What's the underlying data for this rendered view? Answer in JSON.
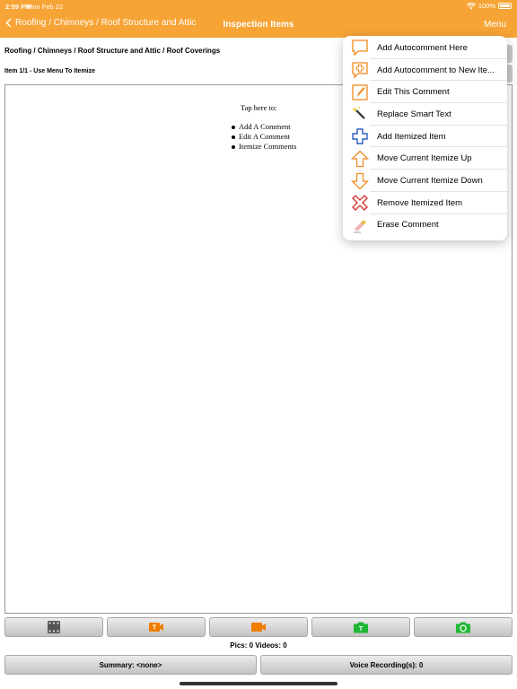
{
  "status": {
    "time": "2:59 PM",
    "date": "Mon Feb 22",
    "battery": "100%"
  },
  "nav": {
    "back_label": "Roofing / Chimneys / Roof Structure and Attic",
    "title": "Inspection Items",
    "menu_label": "Menu"
  },
  "breadcrumb": "Roofing / Chimneys / Roof Structure and Attic / Roof Coverings",
  "item_label": "Item 1/1 - Use Menu To Itemize",
  "comment": {
    "title": "Tap here to:",
    "items": [
      "Add A Comment",
      "Edit A Comment",
      "Itemize Comments"
    ]
  },
  "menu": {
    "items": [
      {
        "label": "Add Autocomment Here",
        "icon": "speech-bubble-icon"
      },
      {
        "label": "Add Autocomment to New Ite...",
        "icon": "speech-bubble-plus-icon"
      },
      {
        "label": "Edit This Comment",
        "icon": "pencil-icon"
      },
      {
        "label": "Replace Smart Text",
        "icon": "magic-wand-icon"
      },
      {
        "label": "Add Itemized Item",
        "icon": "plus-outline-icon"
      },
      {
        "label": "Move Current Itemize Up",
        "icon": "arrow-up-icon"
      },
      {
        "label": "Move Current Itemize Down",
        "icon": "arrow-down-icon"
      },
      {
        "label": "Remove Itemized Item",
        "icon": "red-x-icon"
      },
      {
        "label": "Erase Comment",
        "icon": "eraser-icon"
      }
    ]
  },
  "toolbar": {
    "buttons": [
      {
        "icon": "film-icon",
        "color": "#555555"
      },
      {
        "icon": "video-text-icon",
        "color": "#f07c00"
      },
      {
        "icon": "video-camera-icon",
        "color": "#f07c00"
      },
      {
        "icon": "camera-text-icon",
        "color": "#1fb734"
      },
      {
        "icon": "camera-icon",
        "color": "#1fb734"
      }
    ]
  },
  "counts": "Pics: 0 Videos: 0",
  "bottom": {
    "summary": "Summary: <none>",
    "voice": "Voice Recording(s): 0"
  },
  "colors": {
    "header": "#f7a436",
    "menu_orange": "#f28a1e",
    "menu_blue": "#2a61b8",
    "menu_red": "#d92c2c"
  }
}
